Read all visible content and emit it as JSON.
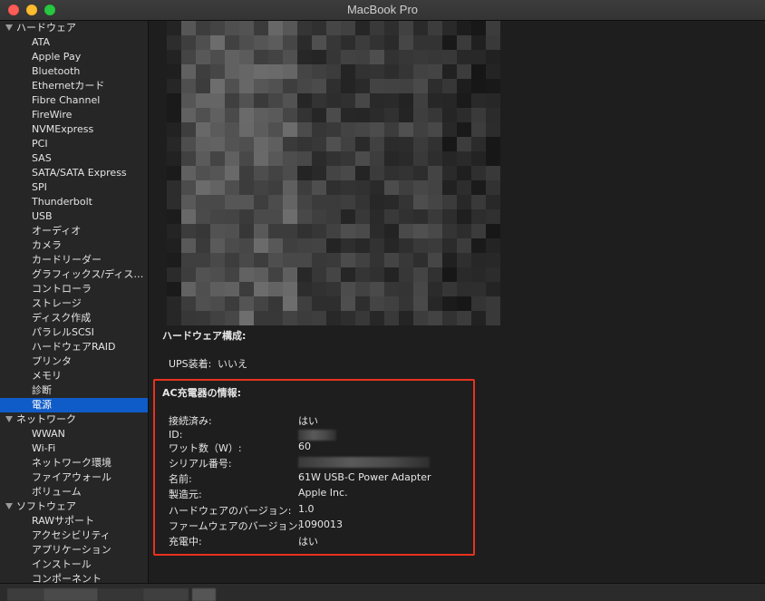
{
  "window": {
    "title": "MacBook Pro"
  },
  "sidebar": {
    "groups": [
      {
        "label": "ハードウェア",
        "items": [
          "ATA",
          "Apple Pay",
          "Bluetooth",
          "Ethernetカード",
          "Fibre Channel",
          "FireWire",
          "NVMExpress",
          "PCI",
          "SAS",
          "SATA/SATA Express",
          "SPI",
          "Thunderbolt",
          "USB",
          "オーディオ",
          "カメラ",
          "カードリーダー",
          "グラフィックス/ディス…",
          "コントローラ",
          "ストレージ",
          "ディスク作成",
          "パラレルSCSI",
          "ハードウェアRAID",
          "プリンタ",
          "メモリ",
          "診断",
          "電源"
        ]
      },
      {
        "label": "ネットワーク",
        "items": [
          "WWAN",
          "Wi-Fi",
          "ネットワーク環境",
          "ファイアウォール",
          "ボリューム"
        ]
      },
      {
        "label": "ソフトウェア",
        "items": [
          "RAWサポート",
          "アクセシビリティ",
          "アプリケーション",
          "インストール",
          "コンポーネント"
        ]
      }
    ],
    "selected_item": "電源"
  },
  "content": {
    "hw_config": {
      "heading": "ハードウェア構成:",
      "ups_label": "UPS装着:",
      "ups_value": "いいえ"
    },
    "ac_charger": {
      "heading": "AC充電器の情報:",
      "rows": [
        {
          "label": "接続済み:",
          "value": "はい"
        },
        {
          "label": "ID:",
          "value": ""
        },
        {
          "label": "ワット数（W）:",
          "value": "60"
        },
        {
          "label": "シリアル番号:",
          "value": ""
        },
        {
          "label": "名前:",
          "value": "61W USB-C Power Adapter"
        },
        {
          "label": "製造元:",
          "value": "Apple Inc."
        },
        {
          "label": "ハードウェアのバージョン:",
          "value": "1.0"
        },
        {
          "label": "ファームウェアのバージョン:",
          "value": "1090013"
        },
        {
          "label": "充電中:",
          "value": "はい"
        }
      ]
    }
  },
  "colors": {
    "selection": "#0f5cc9",
    "highlight_box": "#e8321f",
    "close": "#fd5d57",
    "minimize": "#fdbc2e",
    "maximize": "#27c840"
  }
}
